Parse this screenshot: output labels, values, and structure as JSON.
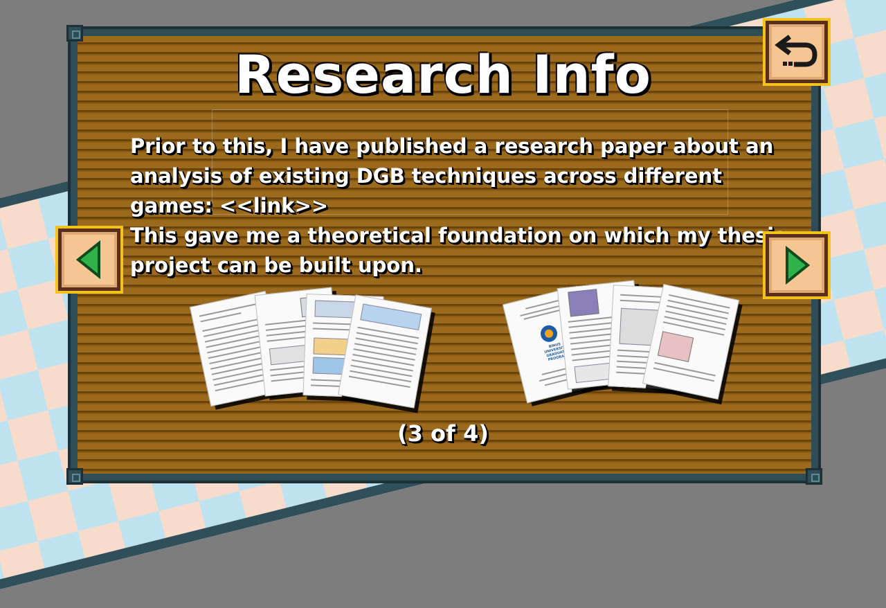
{
  "screen": {
    "title": "Research Info",
    "body_lines": [
      "Prior to this, I have published a research paper about an",
      "analysis of existing DGB techniques across different",
      "games: <<link>>",
      "This gave me a theoretical foundation on which my thesis",
      "project can be built upon."
    ],
    "page_indicator": "(3 of 4)"
  },
  "buttons": {
    "back": {
      "icon": "return-arrow-icon"
    },
    "prev": {
      "icon": "left-triangle-icon"
    },
    "next": {
      "icon": "right-triangle-icon"
    }
  },
  "thumbnails": {
    "paper_1": {
      "label": "research paper pages"
    },
    "paper_2": {
      "label": "thesis proposal pages",
      "logo_lines": [
        "BINUS",
        "UNIVERSITY",
        "GRADUATE",
        "PROGRAM"
      ]
    }
  },
  "colors": {
    "board_wood": "#8a5a12",
    "board_frame": "#2e4d57",
    "button_face": "#f6c692",
    "button_border": "#5a2e1a",
    "button_outline": "#f3c21c",
    "arrow_green": "#2fb24a",
    "checker_pink": "#f8dccb",
    "checker_blue": "#bfe2f0"
  }
}
